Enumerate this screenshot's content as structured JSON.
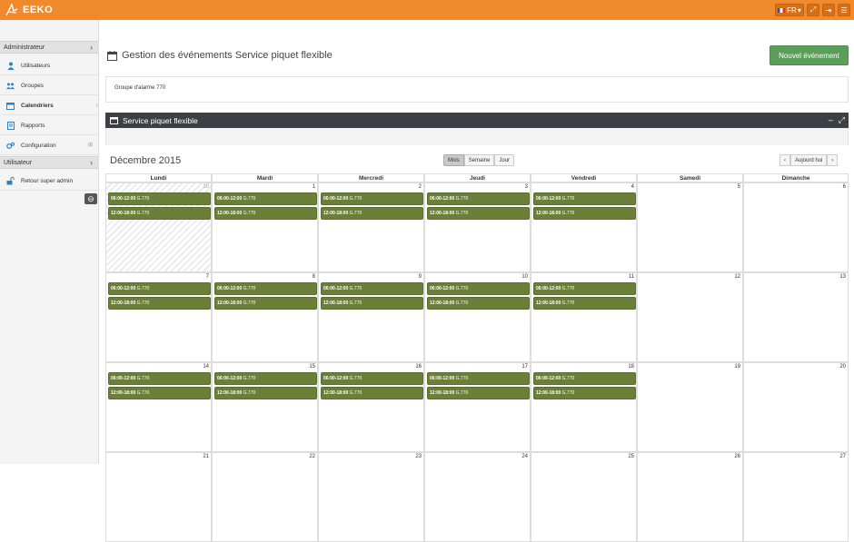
{
  "app": {
    "logo_text": "EEKO"
  },
  "topbar": {
    "lang_label": "FR"
  },
  "sidebar": {
    "section_admin": "Administrateur",
    "items": [
      {
        "label": "Utilisateurs",
        "icon": "user-icon"
      },
      {
        "label": "Groupes",
        "icon": "users-icon"
      },
      {
        "label": "Calendriers",
        "icon": "calendar-icon"
      },
      {
        "label": "Rapports",
        "icon": "document-icon"
      },
      {
        "label": "Configuration",
        "icon": "gears-icon"
      }
    ],
    "section_user": "Utilisateur",
    "user_items": [
      {
        "label": "Retour super admin",
        "icon": "unlock-icon"
      }
    ]
  },
  "page": {
    "title": "Gestion des événements Service piquet flexible",
    "new_event_label": "Nouvel événement",
    "group_label": "Groupe d'alarme 770"
  },
  "panel": {
    "title": "Service piquet flexible"
  },
  "calendar": {
    "month_title": "Décembre 2015",
    "views": [
      "Mois",
      "Semaine",
      "Jour"
    ],
    "active_view": "Mois",
    "today_label": "Aujourd hui",
    "weekdays": [
      "Lundi",
      "Mardi",
      "Mercredi",
      "Jeudi",
      "Vendredi",
      "Samedi",
      "Dimanche"
    ],
    "weeks": [
      [
        "30",
        "1",
        "2",
        "3",
        "4",
        "5",
        "6"
      ],
      [
        "7",
        "8",
        "9",
        "10",
        "11",
        "12",
        "13"
      ],
      [
        "14",
        "15",
        "16",
        "17",
        "18",
        "19",
        "20"
      ],
      [
        "21",
        "22",
        "23",
        "24",
        "25",
        "26",
        "27"
      ]
    ],
    "event_morning": {
      "time": "06:00-12:00",
      "title": "G.770"
    },
    "event_afternoon": {
      "time": "12:00-18:00",
      "title": "G.770"
    },
    "colors": {
      "event": "#6b7f38",
      "topbar": "#f08a2c",
      "new_button": "#5a9e5a"
    }
  }
}
